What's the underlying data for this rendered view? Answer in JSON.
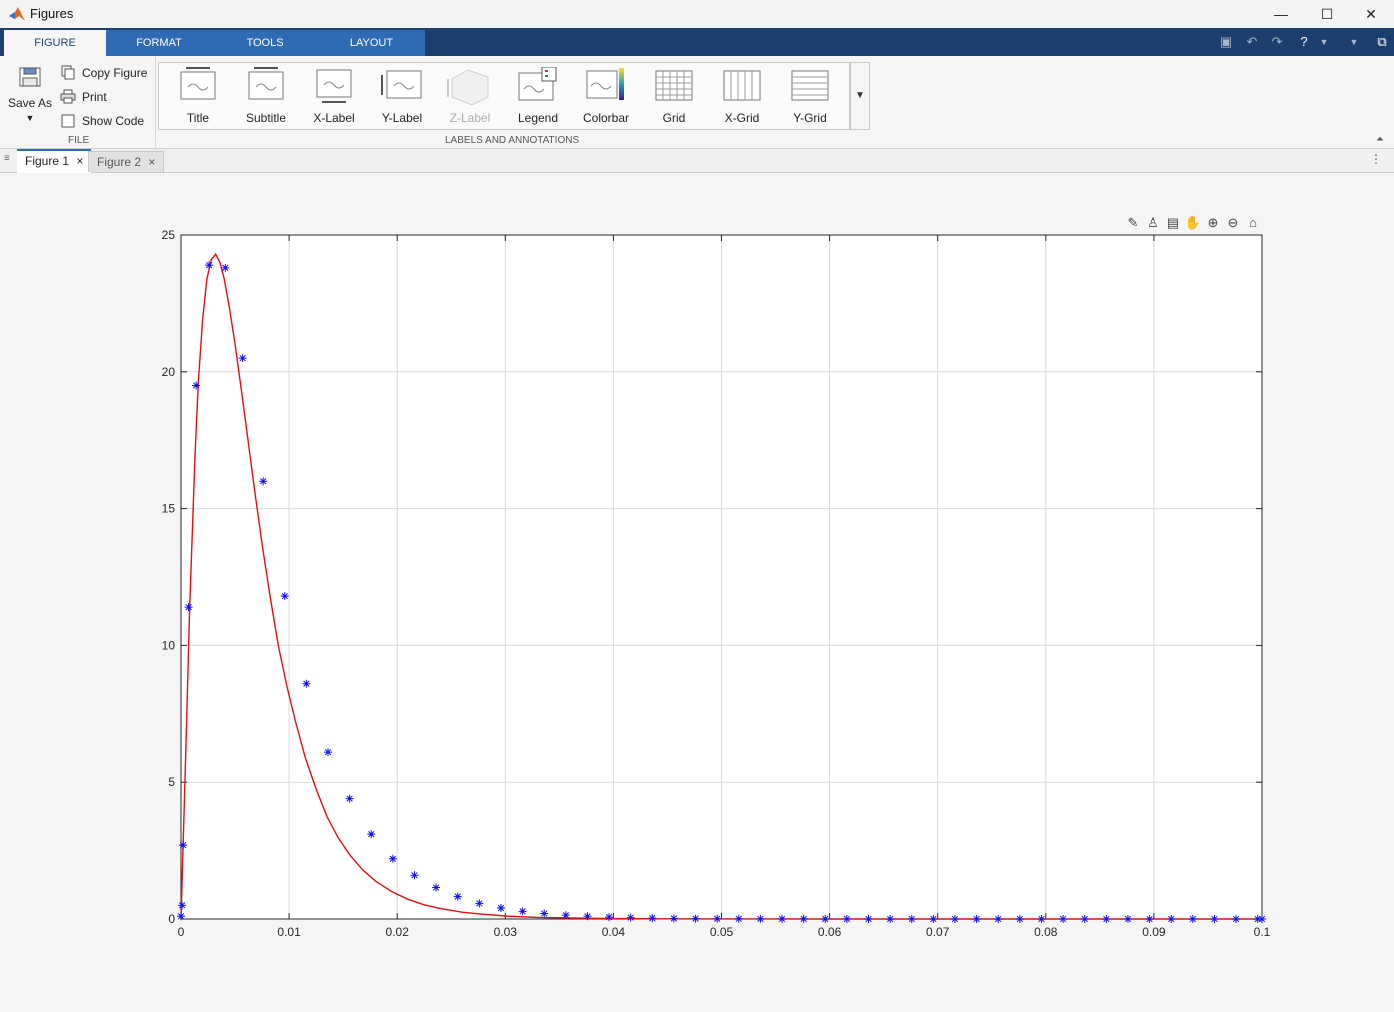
{
  "window": {
    "title": "Figures",
    "minimize": "—",
    "maximize": "☐",
    "close": "✕"
  },
  "ribbon_tabs": [
    "FIGURE",
    "FORMAT",
    "TOOLS",
    "LAYOUT"
  ],
  "file_group": {
    "save_as": "Save As",
    "copy_figure": "Copy Figure",
    "print": "Print",
    "show_code": "Show Code",
    "label": "FILE"
  },
  "annotations_group": {
    "label": "LABELS AND ANNOTATIONS",
    "items": [
      "Title",
      "Subtitle",
      "X-Label",
      "Y-Label",
      "Z-Label",
      "Legend",
      "Colorbar",
      "Grid",
      "X-Grid",
      "Y-Grid"
    ]
  },
  "doc_tabs": [
    {
      "label": "Figure 1",
      "close": "×"
    },
    {
      "label": "Figure 2",
      "close": "×"
    }
  ],
  "colors": {
    "line": "#e01010",
    "marker": "#1010ee",
    "grid": "#d9d9d9",
    "axis": "#262626",
    "ribbon_dark": "#1d3f6e",
    "ribbon_tab": "#2f6bb5"
  },
  "chart_data": {
    "type": "line",
    "title": "",
    "xlabel": "",
    "ylabel": "",
    "xlim": [
      0,
      0.1
    ],
    "ylim": [
      0,
      25
    ],
    "xticks": [
      0,
      0.01,
      0.02,
      0.03,
      0.04,
      0.05,
      0.06,
      0.07,
      0.08,
      0.09,
      0.1
    ],
    "xtick_labels": [
      "0",
      "0.01",
      "0.02",
      "0.03",
      "0.04",
      "0.05",
      "0.06",
      "0.07",
      "0.08",
      "0.09",
      "0.1"
    ],
    "yticks": [
      0,
      5,
      10,
      15,
      20,
      25
    ],
    "ytick_labels": [
      "0",
      "5",
      "10",
      "15",
      "20",
      "25"
    ],
    "grid": true,
    "series": [
      {
        "style": "red solid line",
        "x": [
          0,
          0.0002,
          0.0005,
          0.0008,
          0.001,
          0.0013,
          0.0016,
          0.002,
          0.0024,
          0.0028,
          0.0032,
          0.0036,
          0.004,
          0.0045,
          0.005,
          0.0056,
          0.0062,
          0.0068,
          0.0075,
          0.0082,
          0.009,
          0.0098,
          0.0106,
          0.0115,
          0.0125,
          0.0135,
          0.0145,
          0.0156,
          0.0168,
          0.018,
          0.0195,
          0.021,
          0.0225,
          0.024,
          0.026,
          0.028,
          0.03,
          0.033,
          0.036,
          0.04,
          0.045,
          0.05,
          0.06,
          0.07,
          0.08,
          0.09,
          0.1
        ],
        "y": [
          0,
          2.8,
          6.9,
          11.3,
          13.6,
          17.0,
          19.6,
          21.9,
          23.4,
          24.1,
          24.3,
          24.0,
          23.4,
          22.3,
          21.0,
          19.3,
          17.5,
          15.7,
          13.7,
          11.9,
          10.0,
          8.5,
          7.2,
          5.9,
          4.75,
          3.75,
          3.0,
          2.35,
          1.8,
          1.38,
          1.0,
          0.72,
          0.52,
          0.38,
          0.25,
          0.17,
          0.11,
          0.06,
          0.035,
          0.015,
          0.006,
          0.003,
          0.001,
          0.0,
          0.0,
          0.0,
          0.0
        ]
      },
      {
        "style": "blue asterisk markers",
        "x": [
          0,
          0.0001,
          0.0002,
          0.0007,
          0.0014,
          0.0026,
          0.0041,
          0.0057,
          0.0076,
          0.0096,
          0.0116,
          0.0136,
          0.0156,
          0.0176,
          0.0196,
          0.0216,
          0.0236,
          0.0256,
          0.0276,
          0.0296,
          0.0316,
          0.0336,
          0.0356,
          0.0376,
          0.0396,
          0.0416,
          0.0436,
          0.0456,
          0.0476,
          0.0496,
          0.0516,
          0.0536,
          0.0556,
          0.0576,
          0.0596,
          0.0616,
          0.0636,
          0.0656,
          0.0676,
          0.0696,
          0.0716,
          0.0736,
          0.0756,
          0.0776,
          0.0796,
          0.0816,
          0.0836,
          0.0856,
          0.0876,
          0.0896,
          0.0916,
          0.0936,
          0.0956,
          0.0976,
          0.0996,
          0.1
        ],
        "y": [
          0.1,
          0.5,
          2.7,
          11.4,
          19.5,
          23.9,
          23.8,
          20.5,
          16.0,
          11.8,
          8.6,
          6.1,
          4.4,
          3.1,
          2.2,
          1.6,
          1.15,
          0.82,
          0.57,
          0.4,
          0.28,
          0.2,
          0.14,
          0.1,
          0.07,
          0.05,
          0.03,
          0.02,
          0.015,
          0.01,
          0.008,
          0.005,
          0.004,
          0.003,
          0.002,
          0.001,
          0.001,
          0.0,
          0.0,
          0.0,
          0.0,
          0.0,
          0.0,
          0.0,
          0.0,
          0.0,
          0.0,
          0.0,
          0.0,
          0.0,
          0.0,
          0.0,
          0.0,
          0.0,
          0.0,
          0.0
        ]
      }
    ]
  }
}
